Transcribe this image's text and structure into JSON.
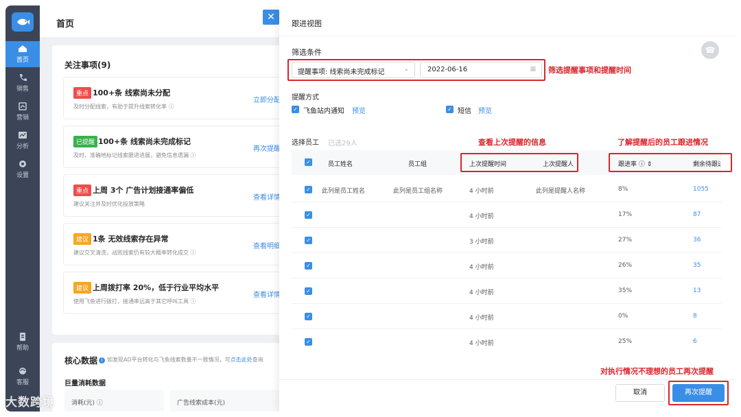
{
  "nav": {
    "items": [
      {
        "label": "首页",
        "icon": "home-icon"
      },
      {
        "label": "销售",
        "icon": "phone-icon"
      },
      {
        "label": "营销",
        "icon": "marketing-icon"
      },
      {
        "label": "分析",
        "icon": "chart-icon"
      },
      {
        "label": "设置",
        "icon": "settings-icon"
      },
      {
        "label": "帮助",
        "icon": "help-icon"
      },
      {
        "label": "客服",
        "icon": "service-icon"
      }
    ]
  },
  "home": {
    "title": "首页",
    "focus_title": "关注事项(9)",
    "todos": [
      {
        "tag": "重点",
        "tag_color": "#f04c4c",
        "head": "100+条 线索尚未分配",
        "sub": "及时分配线索，有助于提升线索转化率",
        "action": "立即分配"
      },
      {
        "tag": "已提醒",
        "tag_color": "#37b24d",
        "head": "100+条 线索尚未完成标记",
        "sub": "及时、准确地标记线索跟进进展，避免信息遗漏",
        "action": "再次提醒"
      },
      {
        "tag": "重点",
        "tag_color": "#f04c4c",
        "head": "上周 3个 广告计划接通率偏低",
        "sub": "建议关注并及时优化投放策略",
        "action": "查看详情"
      },
      {
        "tag": "建议",
        "tag_color": "#f5a623",
        "head": "1条 无效线索存在异常",
        "sub": "建议交叉清洗，战败线索仍有较大概率转化成交",
        "action": "查看明细"
      },
      {
        "tag": "建议",
        "tag_color": "#f5a623",
        "head": "上周拨打率 20%，低于行业平均水平",
        "sub": "使用飞鱼进行拨打，接通率远高于其它呼叫工具",
        "action": "查看详情"
      }
    ],
    "core_title": "核心数据",
    "core_note": "如发现AD平台转化与飞鱼线索数量不一致情况，可",
    "core_link": "点击此处",
    "core_note_tail": "查询",
    "sub_title": "巨量消耗数据",
    "mini_cards": [
      "消耗(元)",
      "广告线索成本(元)"
    ]
  },
  "drawer": {
    "title": "跟进视图",
    "filter_label": "筛选条件",
    "select_value": "提醒事项: 线索尚未完成标记",
    "date_value": "2022-06-16",
    "anno_filter": "筛选提醒事项和提醒时间",
    "remind_label": "提醒方式",
    "remind_options": [
      {
        "label": "飞鱼站内通知",
        "link": "预览"
      },
      {
        "label": "短信",
        "link": "预览"
      }
    ],
    "staff_label": "选择员工",
    "selected_count": "已选29人",
    "anno_last": "查看上次提醒的信息",
    "anno_progress": "了解提醒后的员工跟进情况",
    "columns": [
      "员工姓名",
      "员工组",
      "上次提醒时间",
      "上次提醒人",
      "跟进率",
      "剩余待跟进"
    ],
    "rows": [
      {
        "name": "此列是员工姓名",
        "group": "此列是员工组名称",
        "time": "4 小时前",
        "by": "此列是提醒人名称",
        "rate": "8%",
        "remain": "1055"
      },
      {
        "name": "",
        "group": "",
        "time": "4 小时前",
        "by": "",
        "rate": "17%",
        "remain": "87"
      },
      {
        "name": "",
        "group": "",
        "time": "3 小时前",
        "by": "",
        "rate": "27%",
        "remain": "36"
      },
      {
        "name": "",
        "group": "",
        "time": "4 小时前",
        "by": "",
        "rate": "26%",
        "remain": "35"
      },
      {
        "name": "",
        "group": "",
        "time": "4 小时前",
        "by": "",
        "rate": "35%",
        "remain": "13"
      },
      {
        "name": "",
        "group": "",
        "time": "4 小时前",
        "by": "",
        "rate": "0%",
        "remain": "8"
      },
      {
        "name": "",
        "group": "",
        "time": "4 小时前",
        "by": "",
        "rate": "25%",
        "remain": "6"
      }
    ],
    "anno_footer": "对执行情况不理想的员工再次提醒",
    "cancel_label": "取消",
    "remind_again_label": "再次提醒"
  },
  "watermark": "大数跨境"
}
